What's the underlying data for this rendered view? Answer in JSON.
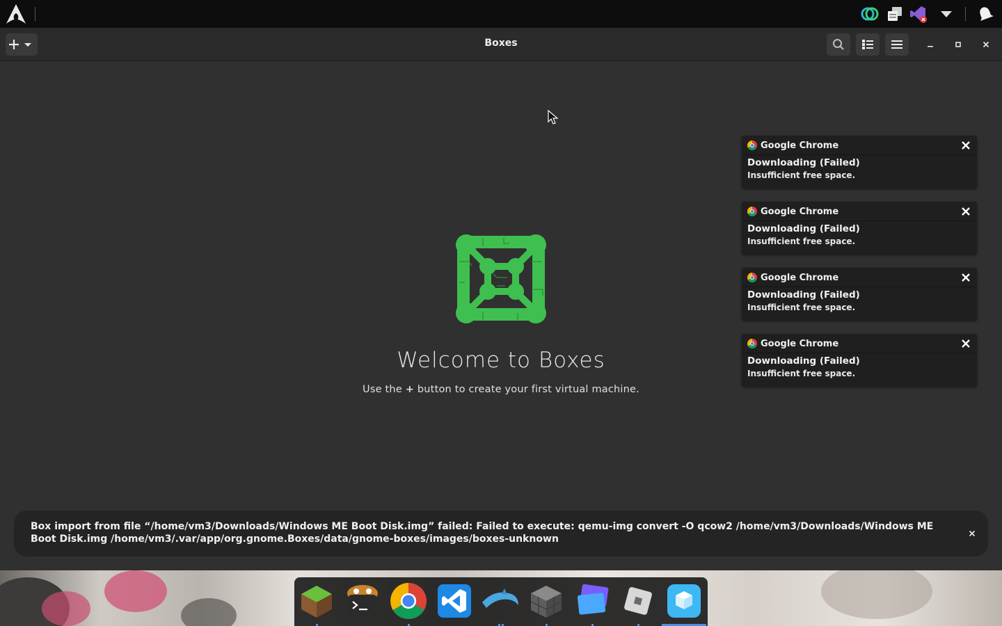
{
  "top_panel": {
    "launcher_icon": "arch-linux-icon",
    "tray_icons": [
      "sync-icon",
      "clipboard-icon",
      "visual-studio-icon",
      "dropdown-arrow-icon",
      "notifications-bell-icon"
    ]
  },
  "headerbar": {
    "title": "Boxes",
    "new_button_icon": "plus-icon",
    "buttons": [
      "search-icon",
      "list-view-icon",
      "hamburger-menu-icon"
    ],
    "window_controls": [
      "minimize-icon",
      "maximize-icon",
      "close-icon"
    ]
  },
  "main": {
    "logo_icon": "boxes-logo-icon",
    "welcome_title": "Welcome to Boxes",
    "welcome_sub_before": "Use the ",
    "welcome_sub_plus": "+",
    "welcome_sub_after": " button to create your first virtual machine."
  },
  "notifications": [
    {
      "app": "Google Chrome",
      "title": "Downloading (Failed)",
      "body": "Insufficient free space."
    },
    {
      "app": "Google Chrome",
      "title": "Downloading (Failed)",
      "body": "Insufficient free space."
    },
    {
      "app": "Google Chrome",
      "title": "Downloading (Failed)",
      "body": "Insufficient free space."
    },
    {
      "app": "Google Chrome",
      "title": "Downloading (Failed)",
      "body": "Insufficient free space."
    }
  ],
  "error_banner": {
    "text": "Box import from file “/home/vm3/Downloads/Windows ME Boot Disk.img” failed: Failed to execute: qemu-img convert -O qcow2 /home/vm3/Downloads/Windows ME Boot Disk.img /home/vm3/.var/app/org.gnome.Boxes/data/gnome-boxes/images/boxes-unknown"
  },
  "dock": {
    "items": [
      "minecraft-icon",
      "terminal-icon",
      "google-chrome-icon",
      "vscode-icon",
      "dolphin-emulator-icon",
      "block-icon",
      "stacked-windows-icon",
      "roblox-icon",
      "boxes-app-icon"
    ]
  },
  "colors": {
    "accent": "#4a90e2",
    "logo_green": "#3fbf4f",
    "panel": "#0d0d0d",
    "headerbar": "#2b2b2b",
    "background": "#303030"
  }
}
